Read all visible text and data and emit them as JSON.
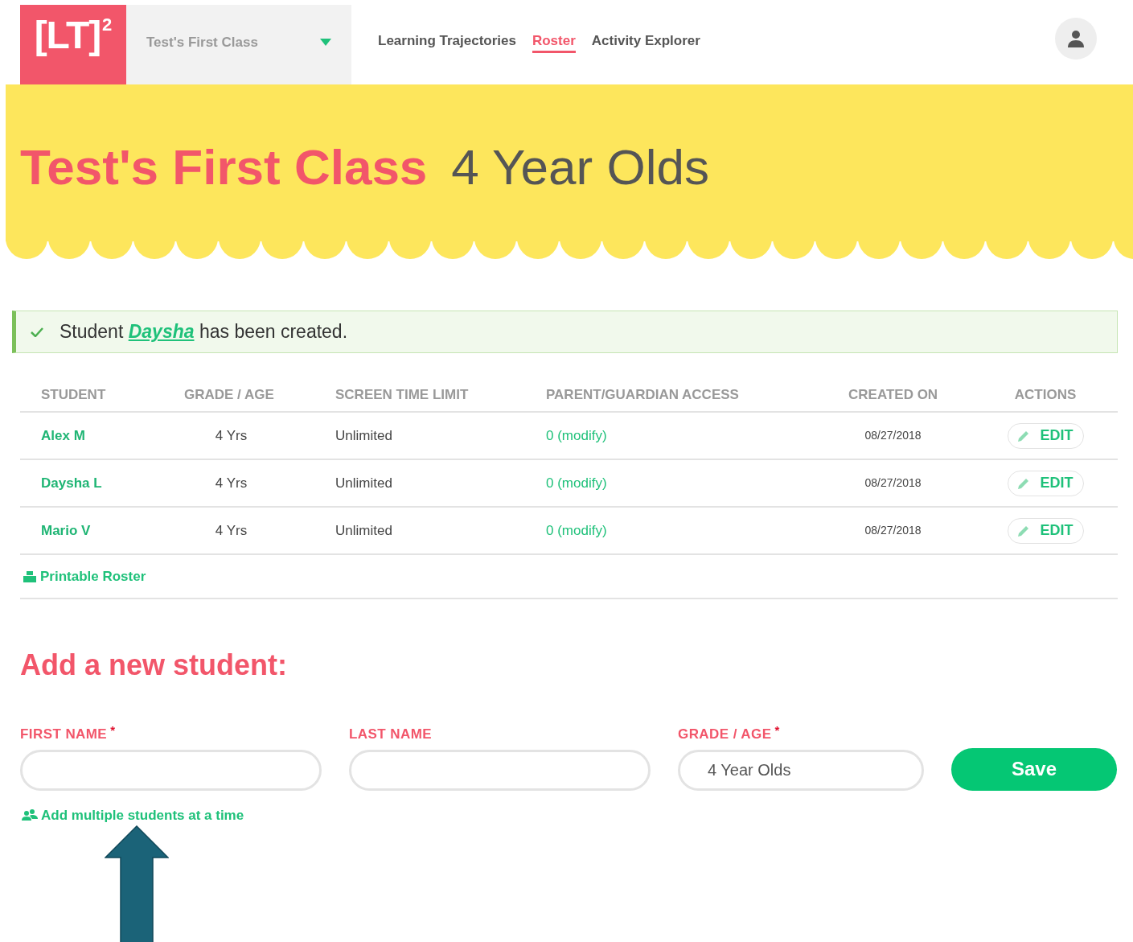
{
  "header": {
    "logo": "[LT]",
    "logo_sup": "2",
    "class_select": {
      "value": "Test's First Class"
    },
    "nav": [
      {
        "label": "Learning Trajectories",
        "selected": false
      },
      {
        "label": "Roster",
        "selected": true
      },
      {
        "label": "Activity Explorer",
        "selected": false
      }
    ]
  },
  "banner": {
    "title": "Test's First Class",
    "subtitle": "4 Year Olds"
  },
  "alert": {
    "prefix": "Student",
    "link": "Daysha",
    "suffix": "has been created."
  },
  "table": {
    "columns": [
      "STUDENT",
      "GRADE / AGE",
      "SCREEN TIME LIMIT",
      "PARENT/GUARDIAN ACCESS",
      "CREATED ON",
      "ACTIONS"
    ],
    "rows": [
      {
        "student": "Alex M",
        "grade": "4 Yrs",
        "screen_time": "Unlimited",
        "access": "0 (modify)",
        "created": "08/27/2018",
        "action": "EDIT"
      },
      {
        "student": "Daysha L",
        "grade": "4 Yrs",
        "screen_time": "Unlimited",
        "access": "0 (modify)",
        "created": "08/27/2018",
        "action": "EDIT"
      },
      {
        "student": "Mario V",
        "grade": "4 Yrs",
        "screen_time": "Unlimited",
        "access": "0 (modify)",
        "created": "08/27/2018",
        "action": "EDIT"
      }
    ],
    "footer_link": "Printable Roster"
  },
  "form": {
    "heading": "Add a new student:",
    "fields": [
      {
        "label": "FIRST NAME",
        "required_mark": "*"
      },
      {
        "label": "LAST NAME"
      },
      {
        "label": "GRADE / AGE",
        "required_mark": "*",
        "value": "4 Year Olds"
      }
    ],
    "save": "Save",
    "multi_link": "Add multiple students at a time"
  }
}
